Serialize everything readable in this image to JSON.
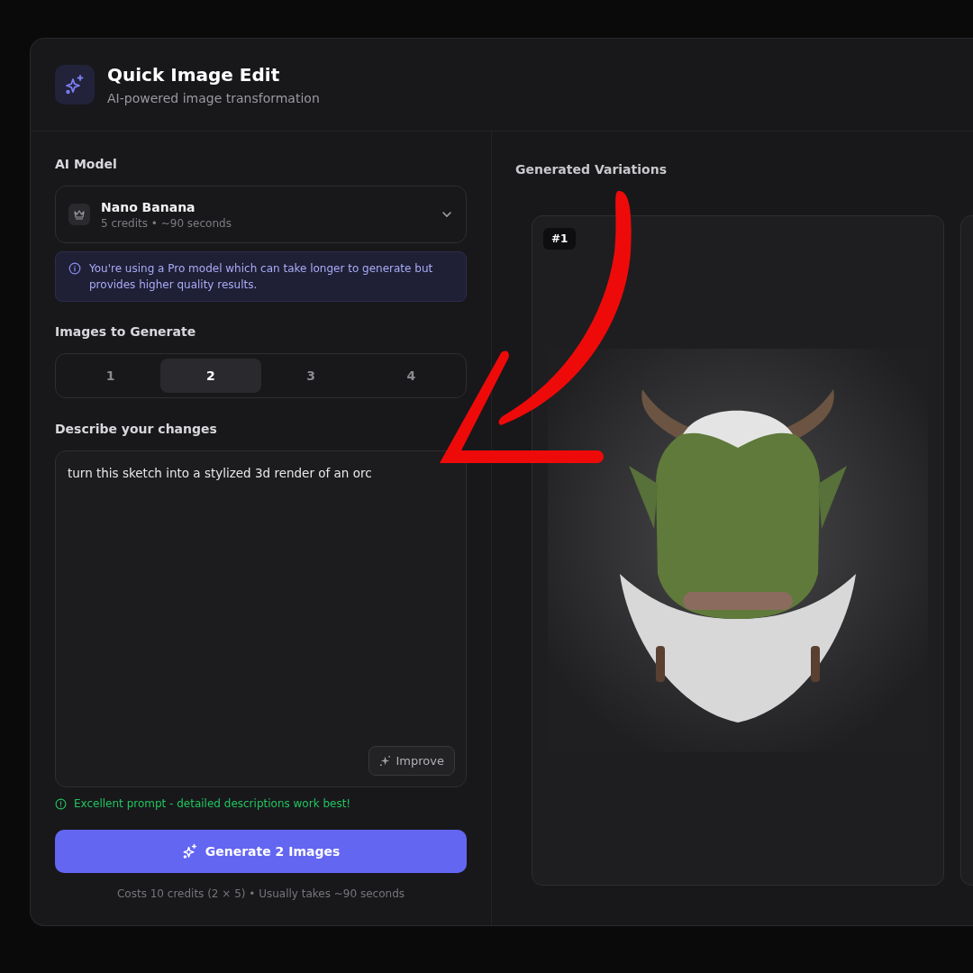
{
  "header": {
    "title": "Quick Image Edit",
    "subtitle": "AI-powered image transformation"
  },
  "model": {
    "label": "AI Model",
    "name": "Nano Banana",
    "details": "5 credits • ~90 seconds",
    "notice": "You're using a Pro model which can take longer to generate but provides higher quality results."
  },
  "count": {
    "label": "Images to Generate",
    "options": [
      {
        "label": "1",
        "selected": false
      },
      {
        "label": "2",
        "selected": true
      },
      {
        "label": "3",
        "selected": false
      },
      {
        "label": "4",
        "selected": false
      }
    ]
  },
  "prompt": {
    "label": "Describe your changes",
    "value": "turn this sketch into a stylized 3d render of an orc",
    "improve_button": "Improve",
    "hint": "Excellent prompt - detailed descriptions work best!"
  },
  "generate_button": "Generate 2 Images",
  "cost_note": "Costs 10 credits (2 × 5) • Usually takes ~90 seconds",
  "variations": {
    "label": "Generated Variations",
    "items": [
      {
        "badge": "#1",
        "kind": "picture"
      }
    ]
  }
}
